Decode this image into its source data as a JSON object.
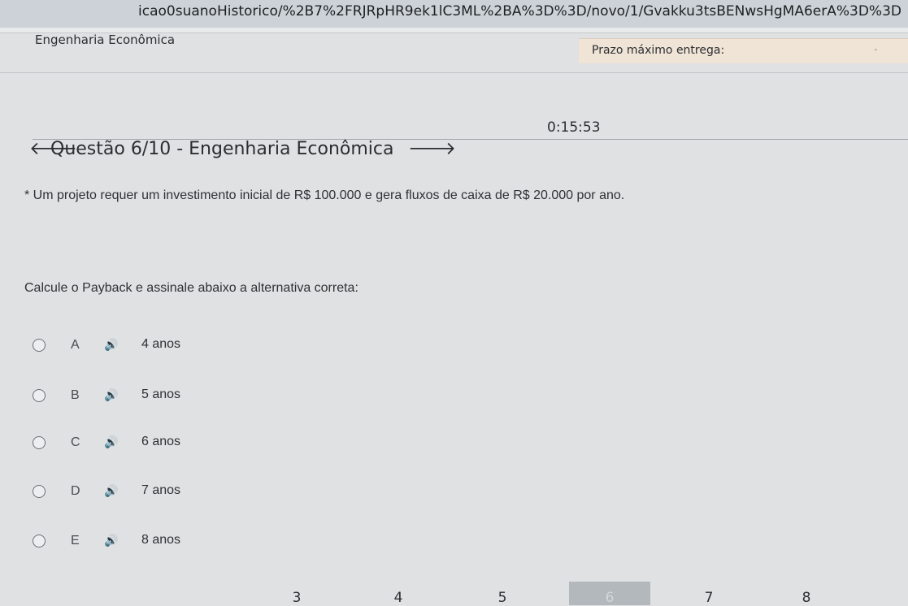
{
  "browser": {
    "url_fragment": "icao0suanoHistorico/%2B7%2FRJRpHR9ek1lC3ML%2BA%3D%3D/novo/1/Gvakku3tsBENwsHgMA6erA%3D%3D"
  },
  "header": {
    "course": "Engenharia Econômica",
    "deadline_label": "Prazo máximo entrega:",
    "deadline_caret": "-"
  },
  "timer": "0:15:53",
  "question": {
    "title": "Questão 6/10 - Engenharia Econômica",
    "statement": "* Um projeto requer um investimento inicial de R$ 100.000 e gera fluxos de caixa de R$ 20.000 por ano.",
    "instruction": "Calcule o Payback e assinale abaixo a alternativa correta:"
  },
  "options": [
    {
      "letter": "A",
      "text": "4 anos"
    },
    {
      "letter": "B",
      "text": "5 anos"
    },
    {
      "letter": "C",
      "text": "6 anos"
    },
    {
      "letter": "D",
      "text": "7 anos"
    },
    {
      "letter": "E",
      "text": "8 anos"
    }
  ],
  "pagination": {
    "pages": [
      "3",
      "4",
      "5",
      "6",
      "7",
      "8"
    ],
    "current": "6"
  },
  "icons": {
    "prev": "arrow-left-icon",
    "next": "arrow-right-icon",
    "audio": "speaker-icon"
  }
}
